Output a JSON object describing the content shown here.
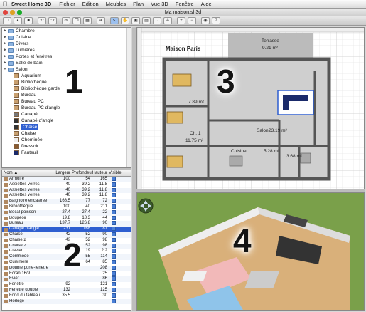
{
  "menubar": {
    "app_name": "Sweet Home 3D",
    "items": [
      "Fichier",
      "Edition",
      "Meubles",
      "Plan",
      "Vue 3D",
      "Fenêtre",
      "Aide"
    ]
  },
  "window": {
    "title": "Ma maison.sh3d"
  },
  "catalog": {
    "categories": [
      "Chambre",
      "Cuisine",
      "Divers",
      "Lumières",
      "Portes et fenêtres",
      "Salle de bain"
    ],
    "open_category": "Salon",
    "items": [
      "Aquarium",
      "Bibliothèque",
      "Bibliothèque garde",
      "Bureau",
      "Bureau PC",
      "Bureau PC d'angle",
      "Canapé",
      "Canapé d'angle",
      "Chaise",
      "Chaise",
      "Cheminée",
      "Dressoir",
      "Fauteuil"
    ],
    "selected_item": "Chaise"
  },
  "furniture_table": {
    "headers": [
      "Nom",
      "Largeur",
      "Profondeur",
      "Hauteur",
      "Visible"
    ],
    "sort_indicator": "▲",
    "rows": [
      [
        "Armoire",
        "100",
        "54",
        "165"
      ],
      [
        "Assiettes verres",
        "40",
        "39.2",
        "11.8"
      ],
      [
        "Assiettes verres",
        "40",
        "39.2",
        "11.8"
      ],
      [
        "Assiettes verres",
        "40",
        "39.2",
        "11.8"
      ],
      [
        "Baignoire encastrée",
        "168.5",
        "77",
        "72"
      ],
      [
        "Bibliothèque",
        "100",
        "40",
        "211"
      ],
      [
        "Bocal poisson",
        "27.4",
        "27.4",
        "22"
      ],
      [
        "Bougeoir",
        "19.8",
        "18.3",
        "44"
      ],
      [
        "Bureau",
        "137.7",
        "126.8",
        "90"
      ],
      [
        "Canapé d'angle",
        "231",
        "168",
        "87"
      ],
      [
        "Chaise",
        "42",
        "52",
        "90"
      ],
      [
        "Chaise 2",
        "42",
        "52",
        "98"
      ],
      [
        "Chaise 2",
        "42",
        "52",
        "98"
      ],
      [
        "Clavier",
        "",
        "19",
        "2.2"
      ],
      [
        "Commode",
        "",
        "55",
        "114"
      ],
      [
        "Cuisinière",
        "",
        "64",
        "85"
      ],
      [
        "Double porte-fenêtre",
        "",
        "",
        "208"
      ],
      [
        "Ecran 16/9",
        "",
        "",
        "25"
      ],
      [
        "Evier",
        "",
        "",
        "86"
      ],
      [
        "Fenêtre",
        "92",
        "",
        "121"
      ],
      [
        "Fenêtre double",
        "132",
        "",
        "125"
      ],
      [
        "Fond du tableau",
        "35.5",
        "",
        "30"
      ],
      [
        "Horloge",
        "",
        "",
        ""
      ]
    ],
    "selected_row": "Canapé d'angle"
  },
  "plan": {
    "house_name": "Maison Paris",
    "rooms": [
      {
        "name": "Terrasse",
        "area": "9.21 m²"
      },
      {
        "name": "",
        "area": "7.89 m²"
      },
      {
        "name": "Ch. 1",
        "area": "11.75 m²"
      },
      {
        "name": "Salon",
        "area": "23.19 m²"
      },
      {
        "name": "Cuisine",
        "area": "5.28 m²"
      },
      {
        "name": "",
        "area": "3.68 m²"
      }
    ]
  },
  "overlay_numbers": [
    "1",
    "2",
    "3",
    "4"
  ],
  "colors": {
    "selection": "#2f5fd0",
    "wall": "#555555",
    "floor": "#cfcfcf",
    "grass": "#7aa04a",
    "room_floor": "#d9b07a"
  }
}
